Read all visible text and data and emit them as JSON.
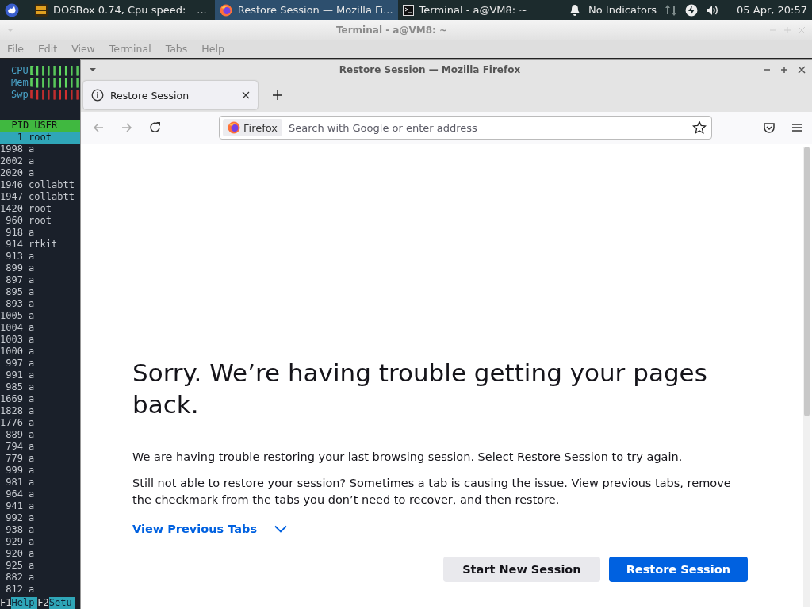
{
  "panel": {
    "tasks": [
      {
        "kind": "dosbox",
        "label": "DOSBox 0.74, Cpu speed:",
        "selected": false
      },
      {
        "kind": "firefox",
        "label": "Restore Session — Mozilla Fi...",
        "selected": true
      },
      {
        "kind": "terminal",
        "label": "Terminal - a@VM8: ~",
        "selected": false
      }
    ],
    "overflow": "...",
    "indicators": "No Indicators",
    "clock": "05 Apr, 20:57"
  },
  "terminal": {
    "title": "Terminal - a@VM8: ~",
    "menu": [
      "File",
      "Edit",
      "View",
      "Terminal",
      "Tabs",
      "Help"
    ],
    "meters": [
      {
        "label": "CPU",
        "bar": "[||||||||",
        "color": "#5fd75f"
      },
      {
        "label": "Mem",
        "bar": "[||||||||",
        "color": "#5fd75f"
      },
      {
        "label": "Swp",
        "bar": "[||||||||",
        "color": "#d03030"
      }
    ],
    "header": [
      "PID",
      "USER"
    ],
    "rows": [
      {
        "pid": "1",
        "user": "root",
        "selected": true
      },
      {
        "pid": "1998",
        "user": "a",
        "selected": false
      },
      {
        "pid": "2002",
        "user": "a",
        "selected": false
      },
      {
        "pid": "2020",
        "user": "a",
        "selected": false
      },
      {
        "pid": "1946",
        "user": "collabtt",
        "selected": false
      },
      {
        "pid": "1947",
        "user": "collabtt",
        "selected": false
      },
      {
        "pid": "1420",
        "user": "root",
        "selected": false
      },
      {
        "pid": "960",
        "user": "root",
        "selected": false
      },
      {
        "pid": "918",
        "user": "a",
        "selected": false
      },
      {
        "pid": "914",
        "user": "rtkit",
        "selected": false
      },
      {
        "pid": "913",
        "user": "a",
        "selected": false
      },
      {
        "pid": "899",
        "user": "a",
        "selected": false
      },
      {
        "pid": "897",
        "user": "a",
        "selected": false
      },
      {
        "pid": "895",
        "user": "a",
        "selected": false
      },
      {
        "pid": "893",
        "user": "a",
        "selected": false
      },
      {
        "pid": "1005",
        "user": "a",
        "selected": false
      },
      {
        "pid": "1004",
        "user": "a",
        "selected": false
      },
      {
        "pid": "1003",
        "user": "a",
        "selected": false
      },
      {
        "pid": "1000",
        "user": "a",
        "selected": false
      },
      {
        "pid": "997",
        "user": "a",
        "selected": false
      },
      {
        "pid": "991",
        "user": "a",
        "selected": false
      },
      {
        "pid": "985",
        "user": "a",
        "selected": false
      },
      {
        "pid": "1669",
        "user": "a",
        "selected": false
      },
      {
        "pid": "1828",
        "user": "a",
        "selected": false
      },
      {
        "pid": "1776",
        "user": "a",
        "selected": false
      },
      {
        "pid": "889",
        "user": "a",
        "selected": false
      },
      {
        "pid": "794",
        "user": "a",
        "selected": false
      },
      {
        "pid": "779",
        "user": "a",
        "selected": false
      },
      {
        "pid": "999",
        "user": "a",
        "selected": false
      },
      {
        "pid": "981",
        "user": "a",
        "selected": false
      },
      {
        "pid": "964",
        "user": "a",
        "selected": false
      },
      {
        "pid": "941",
        "user": "a",
        "selected": false
      },
      {
        "pid": "992",
        "user": "a",
        "selected": false
      },
      {
        "pid": "938",
        "user": "a",
        "selected": false
      },
      {
        "pid": "929",
        "user": "a",
        "selected": false
      },
      {
        "pid": "920",
        "user": "a",
        "selected": false
      },
      {
        "pid": "925",
        "user": "a",
        "selected": false
      },
      {
        "pid": "882",
        "user": "a",
        "selected": false
      },
      {
        "pid": "812",
        "user": "a",
        "selected": false
      }
    ],
    "footer": [
      {
        "key": "F1",
        "label": "Help"
      },
      {
        "key": "F2",
        "label": "Setu"
      }
    ]
  },
  "firefox": {
    "title": "Restore Session — Mozilla Firefox",
    "tabs": [
      {
        "label": "Restore Session",
        "selected": true
      }
    ],
    "address": {
      "identity": "Firefox",
      "placeholder": "Search with Google or enter address"
    },
    "page": {
      "heading": "Sorry. We’re having trouble getting your pages back.",
      "paragraphs": [
        "We are having trouble restoring your last browsing session. Select Restore Session to try again.",
        "Still not able to restore your session? Sometimes a tab is causing the issue. View previous tabs, remove the checkmark from the tabs you don’t need to recover, and then restore."
      ],
      "link": "View Previous Tabs",
      "buttons": [
        {
          "label": "Start New Session",
          "kind": "secondary"
        },
        {
          "label": "Restore Session",
          "kind": "primary"
        }
      ]
    }
  }
}
